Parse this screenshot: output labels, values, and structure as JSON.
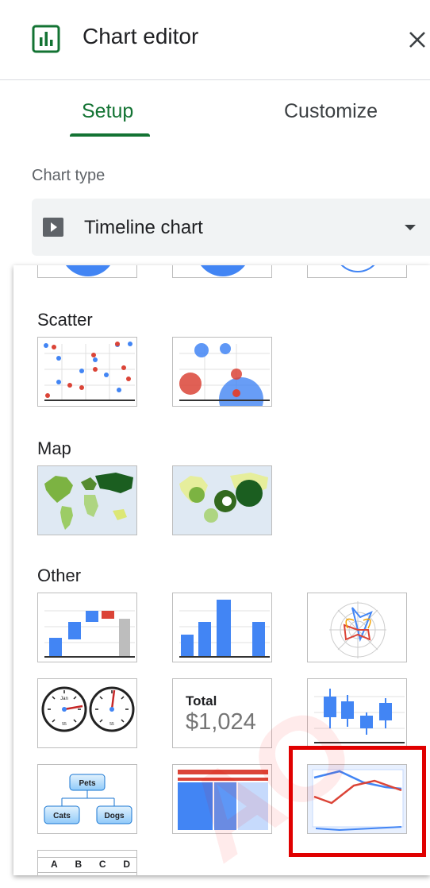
{
  "header": {
    "title": "Chart editor"
  },
  "tabs": [
    {
      "label": "Setup"
    },
    {
      "label": "Customize"
    }
  ],
  "chart_type": {
    "label": "Chart type",
    "selected": "Timeline chart"
  },
  "sections": {
    "scatter": "Scatter",
    "map": "Map",
    "other": "Other"
  },
  "gauge": {
    "month": "Jan",
    "small": "55"
  },
  "scorecard": {
    "label": "Total",
    "value": "$1,024"
  },
  "org": {
    "root": "Pets",
    "left": "Cats",
    "right": "Dogs"
  },
  "table_letters": [
    "A",
    "B",
    "C",
    "D"
  ],
  "colors": {
    "green": "#137333",
    "blue": "#4285f4",
    "red": "#db4437",
    "highlight": "#e00000"
  }
}
